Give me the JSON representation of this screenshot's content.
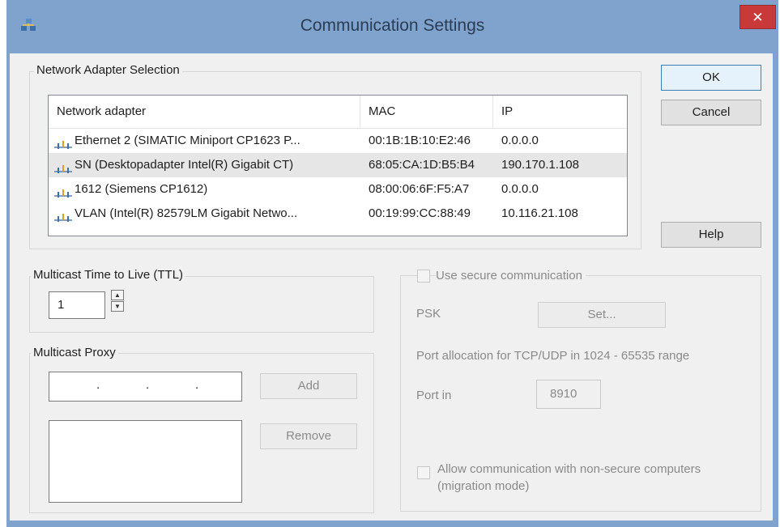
{
  "window": {
    "title": "Communication Settings",
    "close_glyph": "✕"
  },
  "adapter_group": {
    "label": "Network Adapter Selection",
    "columns": [
      "Network adapter",
      "MAC",
      "IP"
    ],
    "rows": [
      {
        "name": "Ethernet 2 (SIMATIC Miniport CP1623 P...",
        "mac": "00:1B:1B:10:E2:46",
        "ip": "0.0.0.0",
        "selected": false
      },
      {
        "name": "SN (Desktopadapter Intel(R) Gigabit CT)",
        "mac": "68:05:CA:1D:B5:B4",
        "ip": "190.170.1.108",
        "selected": true
      },
      {
        "name": "1612 (Siemens CP1612)",
        "mac": "08:00:06:6F:F5:A7",
        "ip": "0.0.0.0",
        "selected": false
      },
      {
        "name": "VLAN (Intel(R) 82579LM Gigabit Netwo...",
        "mac": "00:19:99:CC:88:49",
        "ip": "10.116.21.108",
        "selected": false
      }
    ]
  },
  "buttons": {
    "ok": "OK",
    "cancel": "Cancel",
    "help": "Help",
    "add": "Add",
    "remove": "Remove",
    "set": "Set..."
  },
  "ttl_group": {
    "label": "Multicast Time to Live (TTL)",
    "value": "1"
  },
  "proxy_group": {
    "label": "Multicast Proxy",
    "ip_value": ".     .     ."
  },
  "secure_group": {
    "use_secure_label": "Use secure communication",
    "psk_label": "PSK",
    "port_range_label": "Port allocation for TCP/UDP in 1024 - 65535 range",
    "port_in_label": "Port in",
    "port_in_value": "8910",
    "allow_label_line1": "Allow communication with non-secure computers",
    "allow_label_line2": "(migration mode)"
  },
  "colors": {
    "titlebar": "#7fa3cc",
    "close": "#c9393a",
    "dialog": "#f0f0f0",
    "selected_row": "#e6e6e6"
  }
}
